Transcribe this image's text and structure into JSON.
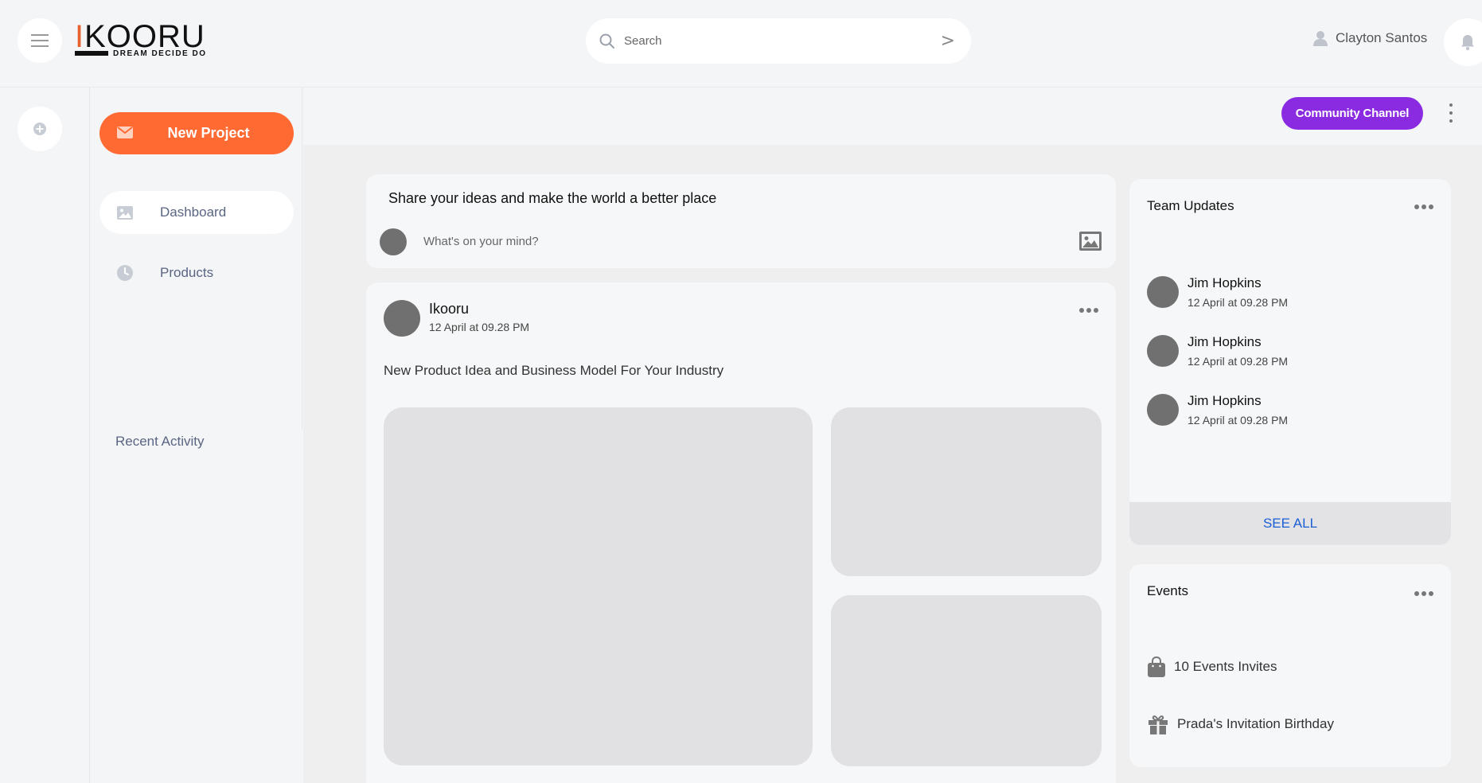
{
  "header": {
    "logo_text": "IKOORU",
    "logo_tagline": "DREAM DECIDE DO",
    "search": {
      "placeholder": "Search",
      "go_label": ">"
    },
    "user_name": "Clayton Santos"
  },
  "sidebar": {
    "new_project_label": "New Project",
    "items": [
      {
        "label": "Dashboard",
        "icon": "image-icon"
      },
      {
        "label": "Products",
        "icon": "clock-icon"
      }
    ],
    "recent_activity_label": "Recent Activity"
  },
  "topbar": {
    "community_label": "Community Channel"
  },
  "share": {
    "title": "Share your ideas and make the world a better place",
    "placeholder": "What's on your mind?"
  },
  "post": {
    "author": "Ikooru",
    "time": "12 April at 09.28 PM",
    "text": "New Product Idea and Business Model For Your Industry"
  },
  "team_updates": {
    "title": "Team Updates",
    "members": [
      {
        "name": "Jim Hopkins",
        "time": "12 April at 09.28 PM"
      },
      {
        "name": "Jim Hopkins",
        "time": "12 April at 09.28 PM"
      },
      {
        "name": "Jim Hopkins",
        "time": "12 April at 09.28 PM"
      }
    ],
    "see_all_label": "SEE ALL"
  },
  "events": {
    "title": "Events",
    "items": [
      {
        "label": "10 Events Invites",
        "icon": "shopping-bag-icon"
      },
      {
        "label": "Prada's Invitation Birthday",
        "icon": "gift-icon"
      }
    ]
  },
  "colors": {
    "accent_orange": "#ff6a33",
    "community_purple": "#8a2be2",
    "link_blue": "#1b5fd6"
  }
}
